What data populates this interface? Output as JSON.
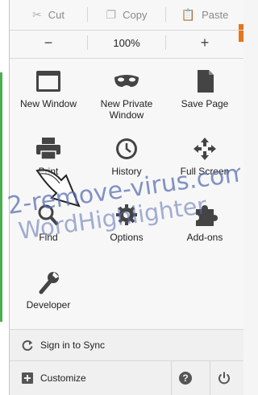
{
  "edit_row": {
    "cut_label": "Cut",
    "copy_label": "Copy",
    "paste_label": "Paste",
    "zoom_out": "−",
    "zoom_level": "100%",
    "zoom_in": "+"
  },
  "grid": {
    "new_window": "New Window",
    "new_private_window_l1": "New Private",
    "new_private_window_l2": "Window",
    "save_page": "Save Page",
    "print": "Print",
    "history": "History",
    "full_screen": "Full Screen",
    "find": "Find",
    "options": "Options",
    "addons": "Add-ons",
    "developer": "Developer"
  },
  "footer": {
    "sign_in_sync": "Sign in to Sync",
    "customize": "Customize"
  },
  "watermark": {
    "line1": "2-remove-virus.com",
    "line2": "WordHighlighter"
  },
  "colors": {
    "accent_orange": "#e8741c",
    "left_bar_green": "#4caf50",
    "watermark_blue": "#5a6fb2"
  }
}
